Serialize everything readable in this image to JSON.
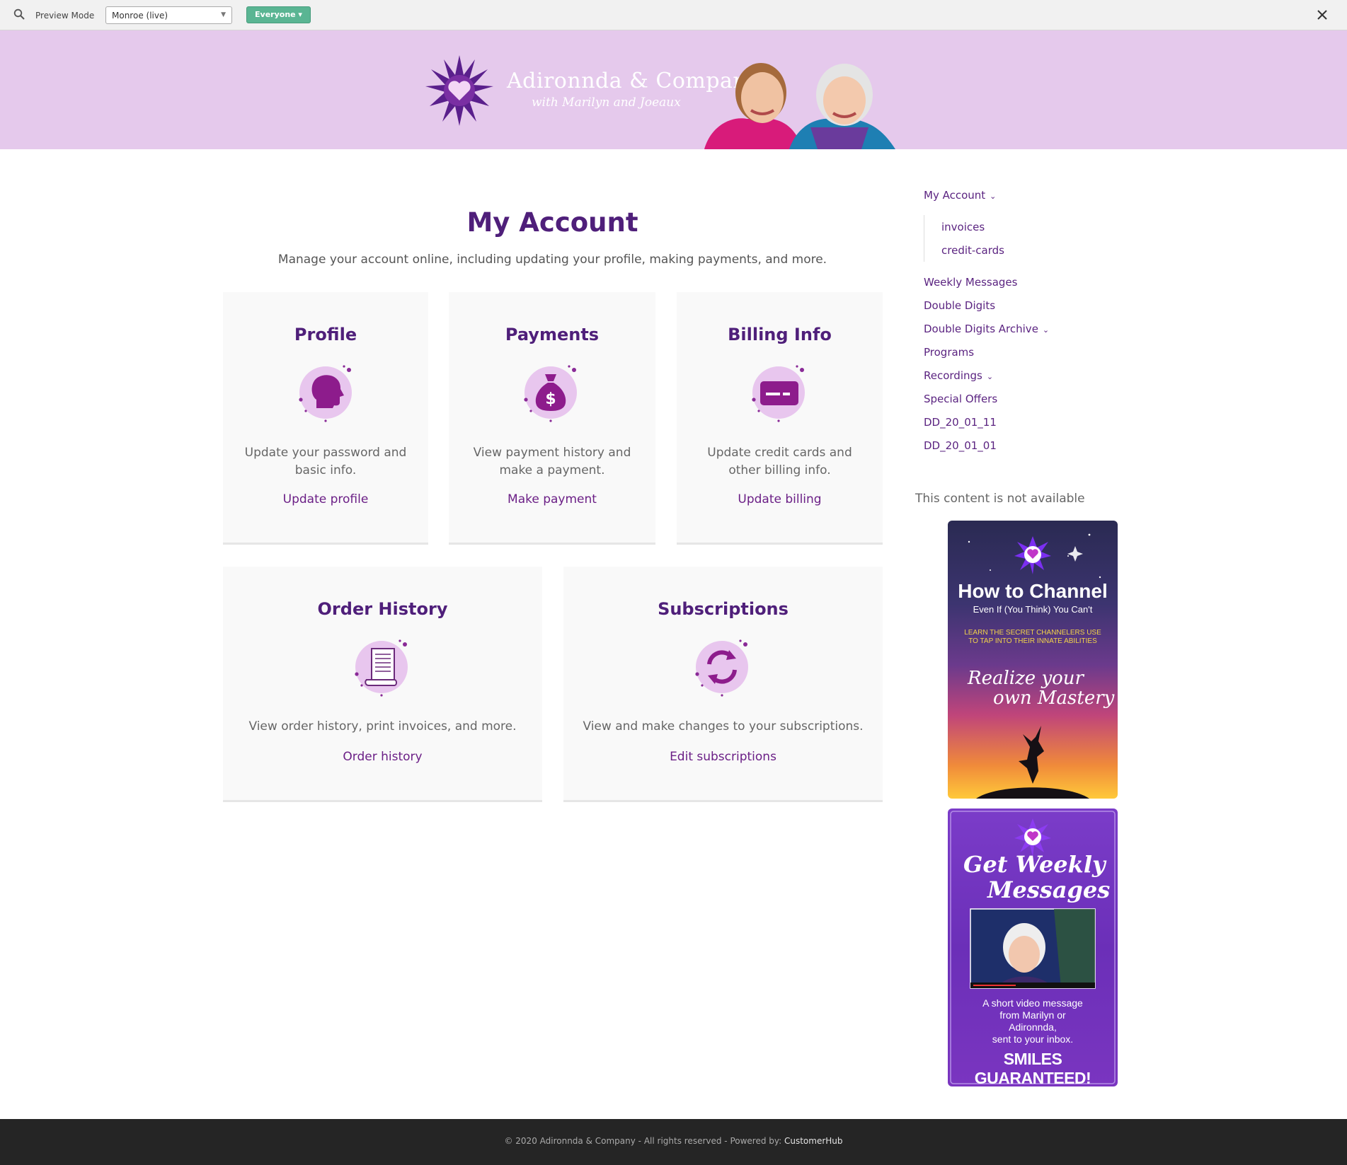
{
  "preview_bar": {
    "label": "Preview Mode",
    "selected_site": "Monroe (live)",
    "audience_button": "Everyone ▾"
  },
  "banner": {
    "title": "Adironnda & Company",
    "subtitle": "with Marilyn and Joeaux"
  },
  "main": {
    "title": "My Account",
    "subtitle": "Manage your account online, including updating your profile, making payments, and more.",
    "cards": [
      {
        "title": "Profile",
        "description": "Update your password and basic info.",
        "link": "Update profile",
        "icon": "profile-head-icon"
      },
      {
        "title": "Payments",
        "description": "View payment history and make a payment.",
        "link": "Make payment",
        "icon": "money-bag-icon"
      },
      {
        "title": "Billing Info",
        "description": "Update credit cards and other billing info.",
        "link": "Update billing",
        "icon": "credit-card-icon"
      },
      {
        "title": "Order History",
        "description": "View order history, print invoices, and more.",
        "link": "Order history",
        "icon": "receipt-icon"
      },
      {
        "title": "Subscriptions",
        "description": "View and make changes to your subscriptions.",
        "link": "Edit subscriptions",
        "icon": "refresh-cycle-icon"
      }
    ]
  },
  "sidebar": {
    "nav": [
      {
        "label": "My Account",
        "has_dropdown": true
      },
      {
        "label": "invoices",
        "sub": true
      },
      {
        "label": "credit-cards",
        "sub": true
      },
      {
        "label": "Weekly Messages"
      },
      {
        "label": "Double Digits"
      },
      {
        "label": "Double Digits Archive",
        "has_dropdown": true
      },
      {
        "label": "Programs"
      },
      {
        "label": "Recordings",
        "has_dropdown": true
      },
      {
        "label": "Special Offers"
      },
      {
        "label": "DD_20_01_11"
      },
      {
        "label": "DD_20_01_01"
      }
    ],
    "not_available": "This content is not available",
    "ads": [
      {
        "title": "How to Channel",
        "tagline": "Even If (You Think) You Can't",
        "highlight_line1": "LEARN THE SECRET CHANNELERS USE",
        "highlight_line2": "TO TAP INTO THEIR INNATE ABILITIES",
        "script_line1": "Realize your",
        "script_line2": "own Mastery"
      },
      {
        "script_line1": "Get Weekly",
        "script_line2": "Messages",
        "caption_line1": "A short video message",
        "caption_line2": "from Marilyn or",
        "caption_line3": "Adironnda,",
        "caption_line4": "sent to your inbox.",
        "banner": "SMILES GUARANTEED!"
      }
    ]
  },
  "footer": {
    "text": "© 2020 Adironnda & Company - All rights reserved - Powered by: ",
    "brand": "CustomerHub"
  },
  "colors": {
    "brand_purple": "#4f1f7a",
    "link_purple": "#6b1f86",
    "banner_bg": "#e5c9ec",
    "icon_circle": "#e8c6ee",
    "footer_bg": "#252525",
    "preview_button": "#5ab593"
  }
}
